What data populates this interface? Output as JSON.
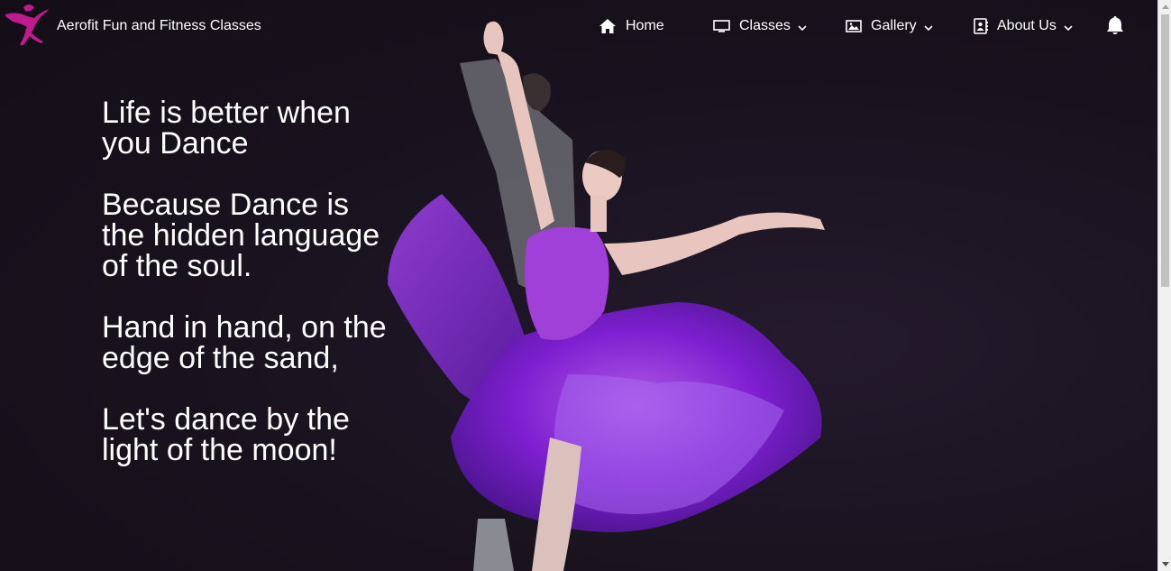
{
  "brand": {
    "name": "Aerofit Fun and Fitness Classes",
    "logo_icon": "dancer-logo-icon",
    "logo_color": "#c01a8c"
  },
  "nav": {
    "items": [
      {
        "label": "Home",
        "icon": "home-icon",
        "dropdown": false
      },
      {
        "label": "Classes",
        "icon": "monitor-icon",
        "dropdown": true
      },
      {
        "label": "Gallery",
        "icon": "image-icon",
        "dropdown": true
      },
      {
        "label": "About Us",
        "icon": "contact-book-icon",
        "dropdown": true
      }
    ],
    "notification_icon": "bell-icon"
  },
  "hero": {
    "stanzas": [
      "Life is better when you Dance",
      "Because Dance is the hidden language of the soul.",
      "Hand in hand, on the edge of the sand,",
      "Let's dance by the light of the moon!"
    ],
    "image_icon": "dancer-illustration",
    "dress_color": "#8a2be2"
  }
}
